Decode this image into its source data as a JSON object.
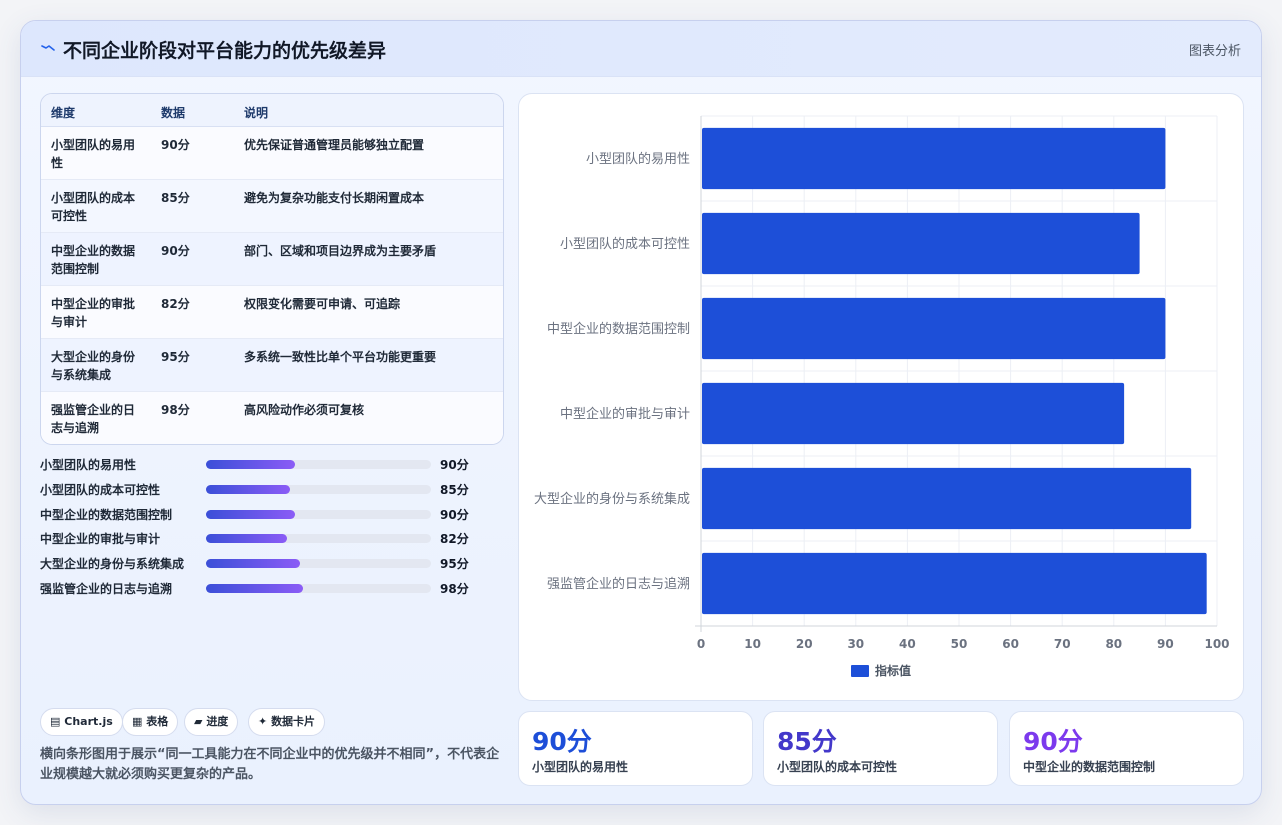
{
  "header": {
    "title": "不同企业阶段对平台能力的优先级差异",
    "analysis_label": "图表分析"
  },
  "table": {
    "columns": [
      "维度",
      "数据",
      "说明"
    ],
    "rows": [
      [
        "小型团队的易用性",
        "90分",
        "优先保证普通管理员能够独立配置"
      ],
      [
        "小型团队的成本可控性",
        "85分",
        "避免为复杂功能支付长期闲置成本"
      ],
      [
        "中型企业的数据范围控制",
        "90分",
        "部门、区域和项目边界成为主要矛盾"
      ],
      [
        "中型企业的审批与审计",
        "82分",
        "权限变化需要可申请、可追踪"
      ],
      [
        "大型企业的身份与系统集成",
        "95分",
        "多系统一致性比单个平台功能更重要"
      ],
      [
        "强监管企业的日志与追溯",
        "98分",
        "高风险动作必须可复核"
      ]
    ]
  },
  "progress": [
    {
      "label": "小型团队的易用性",
      "value": 90,
      "display": "90分"
    },
    {
      "label": "小型团队的成本可控性",
      "value": 85,
      "display": "85分"
    },
    {
      "label": "中型企业的数据范围控制",
      "value": 90,
      "display": "90分"
    },
    {
      "label": "中型企业的审批与审计",
      "value": 82,
      "display": "82分"
    },
    {
      "label": "大型企业的身份与系统集成",
      "value": 95,
      "display": "95分"
    },
    {
      "label": "强监管企业的日志与追溯",
      "value": 98,
      "display": "98分"
    }
  ],
  "tags": [
    {
      "icon": "chart-icon",
      "glyph": "▤",
      "label": "Chart.js"
    },
    {
      "icon": "table-icon",
      "glyph": "▦",
      "label": "表格"
    },
    {
      "icon": "progress-icon",
      "glyph": "▰",
      "label": "进度"
    },
    {
      "icon": "sparkle-icon",
      "glyph": "✦",
      "label": "数据卡片"
    }
  ],
  "note": "横向条形图用于展示“同一工具能力在不同企业中的优先级并不相同”，不代表企业规模越大就必须购买更复杂的产品。",
  "stats": [
    {
      "value": "90分",
      "label": "小型团队的易用性",
      "color": "#1d4ed8"
    },
    {
      "value": "85分",
      "label": "小型团队的成本可控性",
      "color": "#4338ca"
    },
    {
      "value": "90分",
      "label": "中型企业的数据范围控制",
      "color": "#7c3aed"
    }
  ],
  "chart_data": {
    "type": "bar",
    "orientation": "horizontal",
    "categories": [
      "小型团队的易用性",
      "小型团队的成本可控性",
      "中型企业的数据范围控制",
      "中型企业的审批与审计",
      "大型企业的身份与系统集成",
      "强监管企业的日志与追溯"
    ],
    "series": [
      {
        "name": "指标值",
        "values": [
          90,
          85,
          90,
          82,
          95,
          98
        ],
        "color": "#1d4fd8"
      }
    ],
    "xlim": [
      0,
      100
    ],
    "xticks": [
      0,
      10,
      20,
      30,
      40,
      50,
      60,
      70,
      80,
      90,
      100
    ],
    "grid": true,
    "legend": "bottom"
  }
}
